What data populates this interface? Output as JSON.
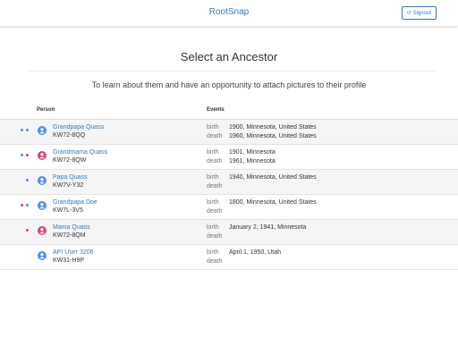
{
  "colors": {
    "link": "#337ab7",
    "male": "#4d8ef0",
    "female": "#e0407a",
    "row_alt": "#f5f5f5"
  },
  "navbar": {
    "brand": "RootSnap",
    "signout_label": "Signout",
    "signout_icon": "signout-icon"
  },
  "page": {
    "title": "Select an Ancestor",
    "subtitle": "To learn about them and have an opportunity to attach pictures to their profile"
  },
  "table": {
    "headers": {
      "person": "Person",
      "events": "Events"
    },
    "rows": [
      {
        "name": "Grandpapa Quass",
        "id": "KW72-8QQ",
        "gender": "male",
        "dots": [
          "male",
          "male"
        ],
        "birth_label": "birth",
        "birth": "1900, Minnesota, United States",
        "death_label": "death",
        "death": "1960, Minnesota, United States"
      },
      {
        "name": "Grandmama Quass",
        "id": "KW72-8QW",
        "gender": "female",
        "dots": [
          "male",
          "female"
        ],
        "birth_label": "birth",
        "birth": "1901, Minnesota",
        "death_label": "death",
        "death": "1961, Minnesota"
      },
      {
        "name": "Papa Quass",
        "id": "KW7V-Y32",
        "gender": "male",
        "dots": [
          "male"
        ],
        "birth_label": "birth",
        "birth": "1940, Minnesota, United States",
        "death_label": "death",
        "death": ""
      },
      {
        "name": "Grandpapa Doe",
        "id": "KW7L-3V5",
        "gender": "male",
        "dots": [
          "female",
          "male"
        ],
        "birth_label": "birth",
        "birth": "1800, Minnesota, United States",
        "death_label": "death",
        "death": ""
      },
      {
        "name": "Mama Quass",
        "id": "KW72-8QM",
        "gender": "female",
        "dots": [
          "female"
        ],
        "birth_label": "birth",
        "birth": "January 2, 1941, Minnesota",
        "death_label": "death",
        "death": ""
      },
      {
        "name": "API User 3206",
        "id": "KW31-H9P",
        "gender": "male",
        "dots": [],
        "birth_label": "birth",
        "birth": "April 1, 1950, Utah",
        "death_label": "death",
        "death": ""
      }
    ]
  }
}
